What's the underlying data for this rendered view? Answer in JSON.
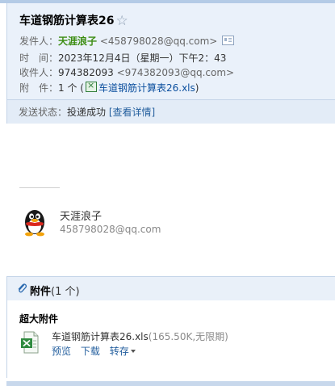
{
  "header": {
    "subject": "车道钢筋计算表26",
    "star_glyph": "☆",
    "sender_label": "发件人：",
    "sender_name": "天涯浪子",
    "sender_addr": "<458798028@qq.com>",
    "time_label": "时　间：",
    "time_value": "2023年12月4日（星期一）下午2：43",
    "to_label": "收件人：",
    "to_name": "974382093",
    "to_addr": "<974382093@qq.com>",
    "attach_label": "附　件：",
    "attach_count": "1 个",
    "attach_file": "车道钢筋计算表26.xls",
    "attach_open": "(",
    "attach_close": ")"
  },
  "status": {
    "label": "发送状态：",
    "value": "投递成功",
    "detail_link": "[查看详情]"
  },
  "signature": {
    "name": "天涯浪子",
    "email": "458798028@qq.com"
  },
  "attachments": {
    "title": "附件",
    "count": "(1 个)",
    "section_label": "超大附件",
    "file_name": "车道钢筋计算表26.xls",
    "file_meta": "(165.50K,无限期)",
    "preview": "预览",
    "download": "下载",
    "save_to": "转存"
  },
  "colors": {
    "header_bg": "#eaf1fa",
    "sender_green": "#3b8c10",
    "link_blue": "#245f9e"
  },
  "icons": [
    "star-icon",
    "contact-card-icon",
    "xls-file-icon",
    "qq-penguin-avatar",
    "paperclip-icon",
    "dropdown-caret-icon"
  ]
}
